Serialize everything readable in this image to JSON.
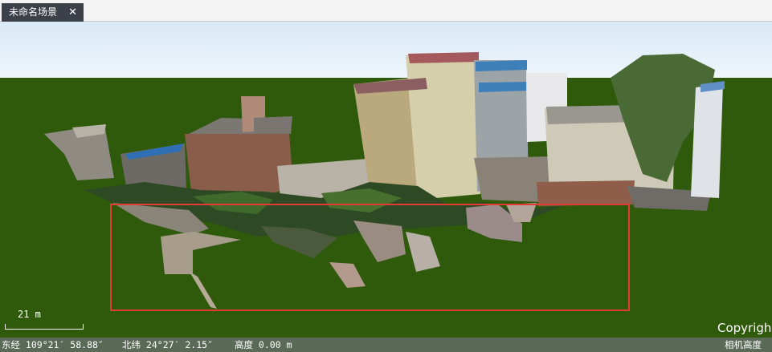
{
  "tab": {
    "title": "未命名场景",
    "close": "✕"
  },
  "scale": {
    "label": "21 m"
  },
  "watermark": "Copyrigh",
  "status": {
    "longitude": "东经 109°21′ 58.88″",
    "latitude": "北纬 24°27′ 2.15″",
    "altitude": "高度 0.00 m",
    "camera": "相机高度"
  },
  "colors": {
    "ground": "#2f5a0c",
    "selection": "#e53935",
    "tab": "#3c4048",
    "statusbar": "#5b6a57"
  }
}
